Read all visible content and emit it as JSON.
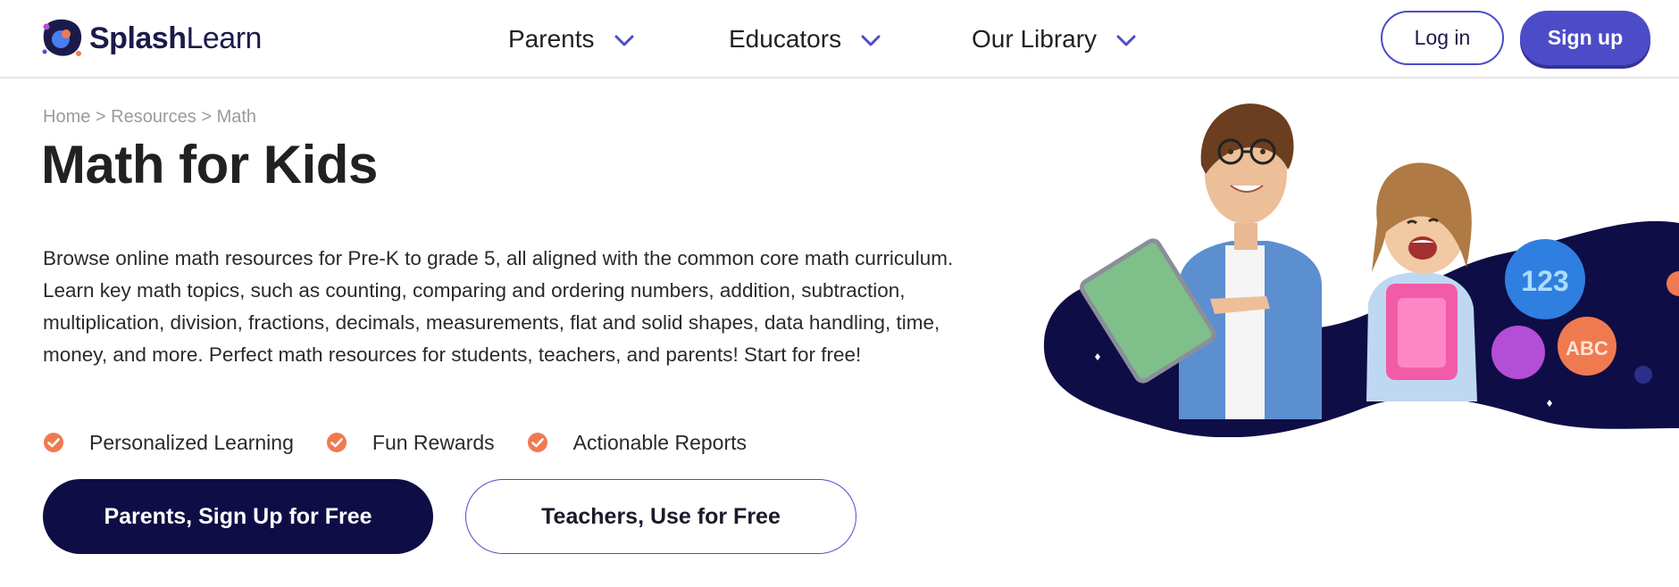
{
  "brand": {
    "name_bold": "Splash",
    "name_light": "Learn"
  },
  "nav": [
    {
      "label": "Parents"
    },
    {
      "label": "Educators"
    },
    {
      "label": "Our Library"
    }
  ],
  "auth": {
    "login": "Log in",
    "signup": "Sign up"
  },
  "breadcrumb": {
    "home": "Home",
    "sep": " > ",
    "resources": "Resources",
    "current": "Math"
  },
  "page": {
    "title": "Math for Kids",
    "description": "Browse online math resources for Pre-K to grade 5, all aligned with the common core math curriculum. Learn key math topics, such as  counting, comparing and ordering numbers, addition, subtraction, multiplication, division, fractions, decimals, measurements, flat and solid shapes, data handling, time, money, and more. Perfect math resources for students, teachers, and parents! Start for free!"
  },
  "features": [
    {
      "label": "Personalized Learning"
    },
    {
      "label": "Fun Rewards"
    },
    {
      "label": "Actionable Reports"
    }
  ],
  "cta": {
    "parents": "Parents, Sign Up for Free",
    "teachers": "Teachers, Use for Free"
  },
  "hero": {
    "badge_numbers": "123",
    "badge_letters": "ABC"
  },
  "colors": {
    "primary": "#4d4cc8",
    "navy": "#0e0d45",
    "accent": "#f07a50",
    "text": "#212121",
    "muted": "#9a9aa0"
  }
}
